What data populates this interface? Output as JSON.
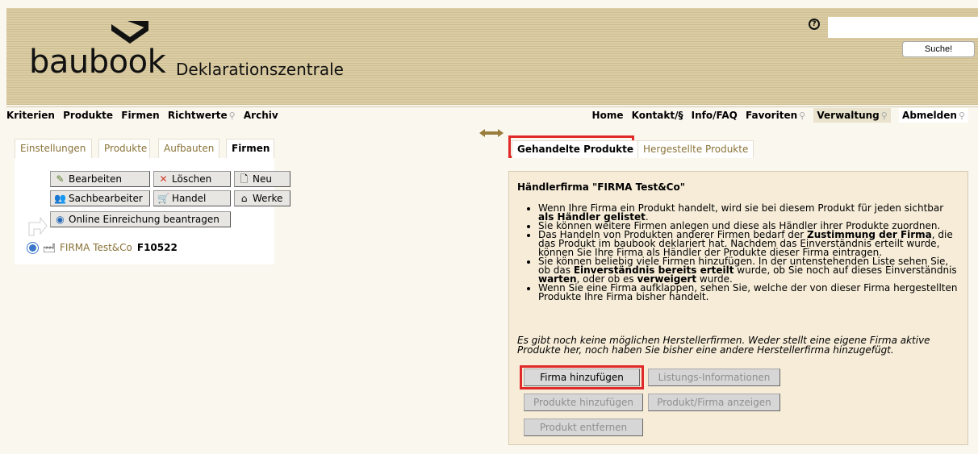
{
  "header": {
    "logo_text": "baubook",
    "logo_sub": "Deklarationszentrale",
    "help_icon": "help-circle-icon",
    "search_placeholder": "",
    "search_button": "Suche!"
  },
  "nav": {
    "left": [
      {
        "label": "Kriterien",
        "locked": false
      },
      {
        "label": "Produkte",
        "locked": false
      },
      {
        "label": "Firmen",
        "locked": false
      },
      {
        "label": "Richtwerte",
        "locked": true
      },
      {
        "label": "Archiv",
        "locked": false
      }
    ],
    "right": [
      {
        "label": "Home",
        "locked": false
      },
      {
        "label": "Kontakt/§",
        "locked": false
      },
      {
        "label": "Info/FAQ",
        "locked": false
      },
      {
        "label": "Favoriten",
        "locked": true
      },
      {
        "label": "Verwaltung",
        "locked": true
      },
      {
        "label": "Abmelden",
        "locked": true
      }
    ]
  },
  "left_tabs": [
    "Einstellungen",
    "Produkte",
    "Aufbauten",
    "Firmen"
  ],
  "toolbar": {
    "bearbeiten": "Bearbeiten",
    "loeschen": "Löschen",
    "neu": "Neu",
    "sachbearbeiter": "Sachbearbeiter",
    "handel": "Handel",
    "werke": "Werke",
    "online": "Online Einreichung beantragen"
  },
  "firm": {
    "name": "FIRMA Test&Co",
    "code": "F10522"
  },
  "right_tabs": {
    "active": "Gehandelte Produkte",
    "other": "Hergestellte Produkte"
  },
  "panel": {
    "title": "Händlerfirma \"FIRMA Test&Co\"",
    "bullets": [
      {
        "pre": "Wenn Ihre Firma ein Produkt handelt, wird sie bei diesem Produkt für jeden sichtbar ",
        "bold": "als Händler gelistet",
        "post": "."
      },
      {
        "pre": "Sie können weitere Firmen anlegen und diese als Händler ihrer Produkte zuordnen.",
        "bold": "",
        "post": ""
      },
      {
        "pre": "Das Handeln von Produkten anderer Firmen bedarf der ",
        "bold": "Zustimmung der Firma",
        "post": ", die das Produkt im baubook deklariert hat. Nachdem das Einverständnis erteilt wurde, können Sie Ihre Firma als Händler der Produkte dieser Firma eintragen."
      },
      {
        "pre": "Sie können beliebig viele Firmen hinzufügen. In der untenstehenden Liste sehen Sie, ob das ",
        "bold": "Einverständnis bereits erteilt",
        "post": " wurde, ob Sie noch auf dieses Einverständnis ",
        "bold2": "warten",
        "post2": ", oder ob es ",
        "bold3": "verweigert",
        "post3": " wurde."
      },
      {
        "pre": "Wenn Sie eine Firma aufklappen, sehen Sie, welche der von dieser Firma hergestellten Produkte Ihre Firma bisher handelt.",
        "bold": "",
        "post": ""
      }
    ],
    "note": "Es gibt noch keine möglichen Herstellerfirmen. Weder stellt eine eigene Firma aktive Produkte her, noch haben Sie bisher eine andere Herstellerfirma hinzugefügt.",
    "btn_firma_hinzufuegen": "Firma hinzufügen",
    "btn_listungs": "Listungs-Informationen",
    "btn_produkte_hinzufuegen": "Produkte hinzufügen",
    "btn_produkt_firma": "Produkt/Firma anzeigen",
    "btn_produkt_entfernen": "Produkt entfernen"
  },
  "colors": {
    "highlight": "#e02a2a",
    "link": "#8a7338",
    "panel_bg": "#f6ecd8"
  }
}
